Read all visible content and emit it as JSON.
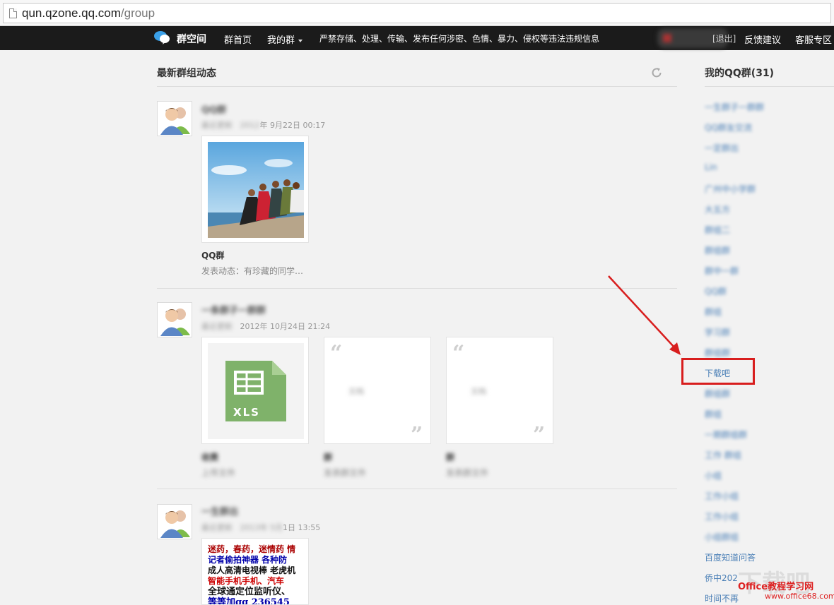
{
  "browser": {
    "url_host": "qun.qzone.qq.com",
    "url_path": "/group"
  },
  "nav": {
    "logo_text": "群空间",
    "home": "群首页",
    "my_groups": "我的群",
    "notice": "严禁存储、处理、传输、发布任何涉密、色情、暴力、侵权等违法违规信息",
    "logout": "[退出]",
    "feedback": "反馈建议",
    "service": "客服专区"
  },
  "main": {
    "title": "最新群组动态",
    "feeds": [
      {
        "name": "QQ群",
        "updated_prefix": "最近更新",
        "date": "年 9月22日 00:17",
        "card_title": "QQ群",
        "card_desc": "发表动态：有珍藏的同学…"
      },
      {
        "name": "一条群子一群群",
        "updated_prefix": "最近更新",
        "date": "2012年 10月24日 21:24",
        "cards": [
          {
            "type": "xls",
            "label": "XLS",
            "title": "收费",
            "desc": "上传文件"
          },
          {
            "type": "quote",
            "body": "文档",
            "title": "群",
            "desc": "发表群文件"
          },
          {
            "type": "quote",
            "body": "文档",
            "title": "群",
            "desc": "发表群文件"
          }
        ]
      },
      {
        "name": "一生群出",
        "updated_prefix": "最近更新",
        "date": "1日 13:55",
        "ad_lines": [
          "迷药，春药，迷情药 情",
          "记者偷拍神器 各种防",
          "成人高清电视棒 老虎机",
          "智能手机手机、汽车",
          "全球通定位监听仪、",
          "等等加qq 236545"
        ]
      }
    ]
  },
  "sidebar": {
    "title": "我的QQ群(31)",
    "items": [
      "一生群子一群群",
      "QQ群友交流",
      "一定群出",
      "Lin",
      "广州中小学群",
      "大五方",
      "群组二",
      "群组群",
      "群中一群",
      "QQ群",
      "群组",
      "学习群",
      "群组群",
      "下载吧",
      "群组群",
      "群组",
      "一期群组群",
      "工作 群组",
      "小组",
      "工作小组",
      "工作小组",
      "小组群组",
      "百度知道问答",
      "侨中202",
      "时间不再"
    ],
    "highlight": "下载吧"
  },
  "watermark": {
    "text": "Office教程学习网",
    "url": "www.office68.com"
  },
  "colors": {
    "nav_bg": "#1b1b1b",
    "link": "#4a7fb6",
    "highlight": "#d81e1e"
  }
}
